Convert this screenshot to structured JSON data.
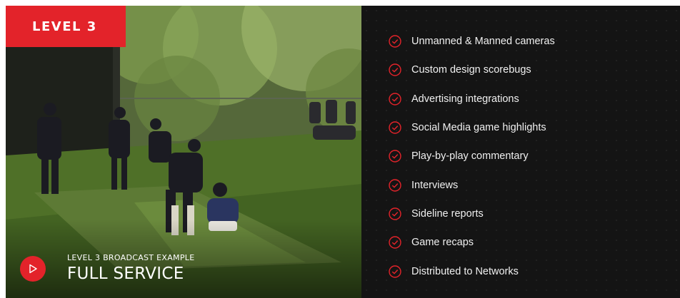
{
  "badge": {
    "label": "LEVEL 3"
  },
  "video": {
    "subtitle": "LEVEL 3 BROADCAST EXAMPLE",
    "title": "FULL SERVICE",
    "play_icon": "play-icon"
  },
  "features": {
    "icon": "check-circle-icon",
    "items": [
      {
        "label": "Unmanned & Manned cameras"
      },
      {
        "label": "Custom design scorebugs"
      },
      {
        "label": "Advertising integrations"
      },
      {
        "label": "Social Media game highlights"
      },
      {
        "label": "Play-by-play commentary"
      },
      {
        "label": "Interviews"
      },
      {
        "label": "Sideline reports"
      },
      {
        "label": "Game recaps"
      },
      {
        "label": "Distributed to Networks"
      }
    ]
  },
  "colors": {
    "accent": "#e3232a",
    "panel": "#141414",
    "text": "#f0f0f0"
  }
}
